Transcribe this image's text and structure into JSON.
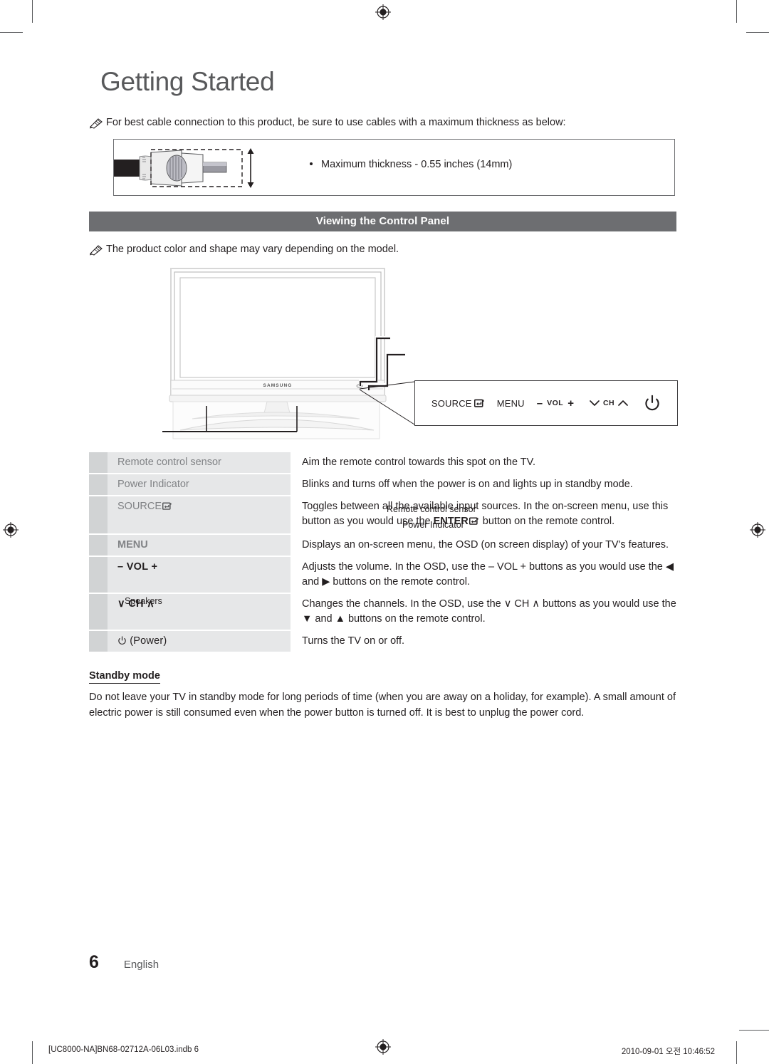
{
  "document": {
    "chapter_title": "Getting Started",
    "page_number": "6",
    "language": "English",
    "footer_left": "[UC8000-NA]BN68-02712A-06L03.indb   6",
    "footer_right": "2010-09-01   오전 10:46:52"
  },
  "cable_note": {
    "icon": "pencil-note-icon",
    "text": "For best cable connection to this product, be sure to use cables with a maximum thickness as below:",
    "bullet": "Maximum thickness - 0.55 inches (14mm)"
  },
  "section": {
    "title": "Viewing the Control Panel",
    "note_icon": "pencil-note-icon",
    "note_text": "The product color and shape may vary depending on the model."
  },
  "diagram": {
    "brand": "SAMSUNG",
    "callouts": {
      "remote_sensor": "Remote control sensor",
      "power_indicator": "Power Indicator",
      "speakers": "Speakers"
    },
    "control_panel_buttons": [
      {
        "label": "SOURCE",
        "icon": "enter-icon"
      },
      {
        "label": "MENU",
        "icon": ""
      },
      {
        "label": "VOL",
        "icon": "minus-plus-icon",
        "prefix": "–",
        "suffix": "+"
      },
      {
        "label": "CH",
        "icon": "chevron-down-up-icon",
        "prefix": "∨",
        "suffix": "∧"
      },
      {
        "label": "",
        "icon": "power-icon"
      }
    ]
  },
  "spec_table": {
    "rows": [
      {
        "label": "Remote control sensor",
        "label_style": "gray",
        "icon": "",
        "desc_lines": [
          "Aim the remote control towards this spot on the TV."
        ]
      },
      {
        "label": "Power Indicator",
        "label_style": "gray",
        "icon": "",
        "desc_lines": [
          "Blinks and turns off when the power is on and lights up in standby mode."
        ]
      },
      {
        "label": "SOURCE",
        "label_style": "gray",
        "icon": "enter-icon",
        "desc_lines": [
          "Toggles between all the available input sources. In the on-screen menu, use this",
          "button as you would use the ENTER ⌨ button on the remote control."
        ]
      },
      {
        "label": "MENU",
        "label_style": "gray",
        "icon": "",
        "desc_lines": [
          "Displays an on-screen menu, the OSD (on screen display) of your TV's features."
        ]
      },
      {
        "label": "– VOL +",
        "label_style": "bold",
        "icon": "",
        "desc_lines": [
          "Adjusts the volume. In the OSD, use the – VOL + buttons as you would use the ◀",
          "and ▶ buttons on the remote control."
        ]
      },
      {
        "label": "∨ CH ∧",
        "label_style": "bold",
        "icon": "",
        "desc_lines": [
          "Changes the channels. In the OSD, use the ∨ CH ∧ buttons as you would use the",
          "▼ and ▲ buttons on the remote control."
        ]
      },
      {
        "label": "(Power)",
        "label_style": "power",
        "icon": "power-icon",
        "desc_lines": [
          "Turns the TV on or off."
        ]
      }
    ]
  },
  "standby": {
    "heading": "Standby mode",
    "body": "Do not leave your TV in standby mode for long periods of time (when you are away on a holiday, for example). A small amount of electric power is still consumed even when the power button is turned off. It is best to unplug the power cord."
  },
  "colors": {
    "section_bar": "#6d6e71",
    "label_cell": "#e6e7e8",
    "swatch_cell": "#d1d3d4",
    "text": "#231f20",
    "gray_text": "#808285"
  }
}
